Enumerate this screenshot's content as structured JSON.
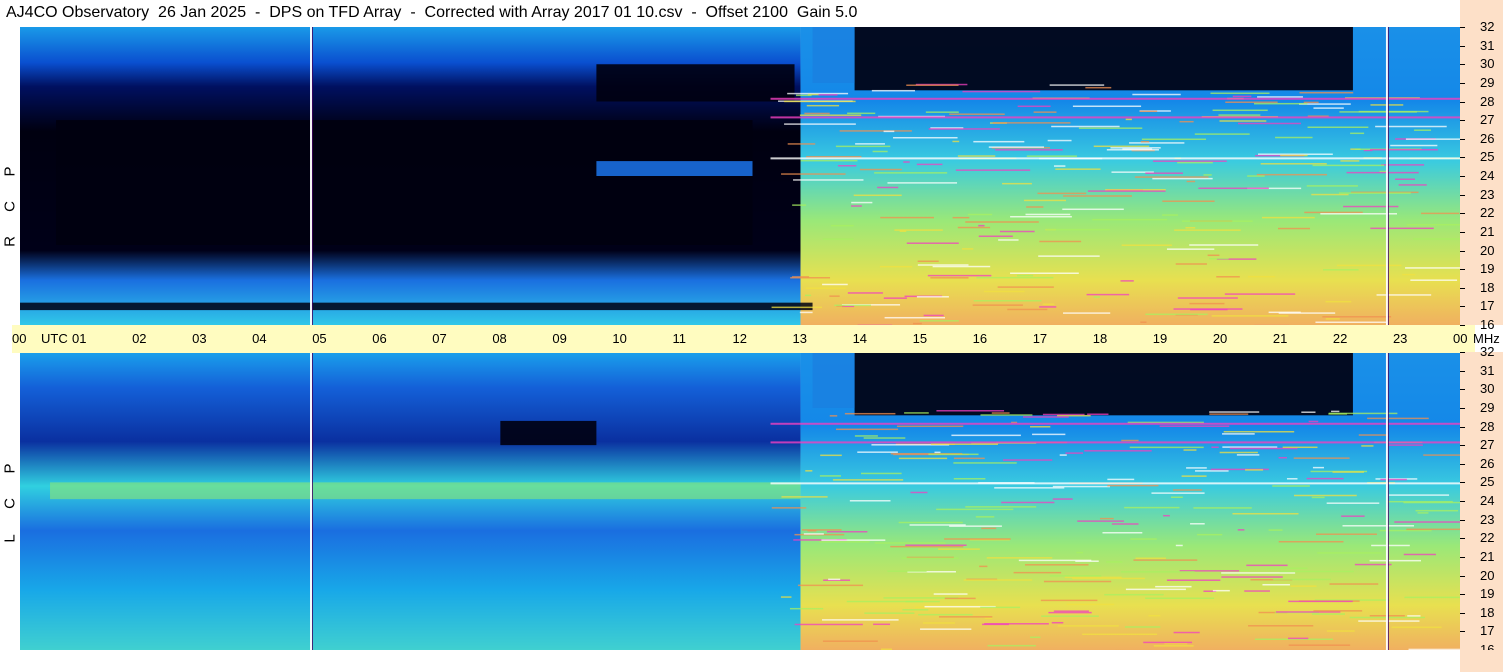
{
  "title": "AJ4CO Observatory  26 Jan 2025  -  DPS on TFD Array  -  Corrected with Array 2017 01 10.csv  -  Offset 2100  Gain 5.0",
  "colors": {
    "background": "#ffffff",
    "time_axis_bg": "#fffcc0",
    "freq_axis_bg": "#fde0c8",
    "deep": "#000010",
    "blue": "#0a5be0",
    "cyan": "#1fc8f0",
    "green": "#a8f060",
    "yellow": "#f0e040",
    "orange": "#f09050",
    "magenta": "#f040c0"
  },
  "chart_data": {
    "type": "heatmap",
    "title": "AJ4CO Observatory  26 Jan 2025  -  DPS on TFD Array  -  Corrected with Array 2017 01 10.csv  -  Offset 2100  Gain 5.0",
    "x_unit": "UTC",
    "y_unit": "MHz",
    "x_ticks": [
      "00",
      "01",
      "02",
      "03",
      "04",
      "05",
      "06",
      "07",
      "08",
      "09",
      "10",
      "11",
      "12",
      "13",
      "14",
      "15",
      "16",
      "17",
      "18",
      "19",
      "20",
      "21",
      "22",
      "23",
      "00"
    ],
    "x_range_hours": [
      0,
      24
    ],
    "y_ticks": [
      16,
      17,
      18,
      19,
      20,
      21,
      22,
      23,
      24,
      25,
      26,
      27,
      28,
      29,
      30,
      31,
      32
    ],
    "y_range_mhz": [
      16,
      32
    ],
    "panels": [
      {
        "name": "R C P",
        "letters": [
          "P",
          "C",
          "R"
        ]
      },
      {
        "name": "L C P",
        "letters": [
          "P",
          "C",
          "L"
        ]
      }
    ],
    "vertical_lines_utc": [
      4.83,
      22.75
    ],
    "features": {
      "quiet_dark_period_utc": [
        0.5,
        12.8
      ],
      "bright_daytime_period_utc": [
        13.0,
        23.9
      ],
      "deep_dark_block_utc": [
        13.9,
        22.2
      ]
    }
  }
}
